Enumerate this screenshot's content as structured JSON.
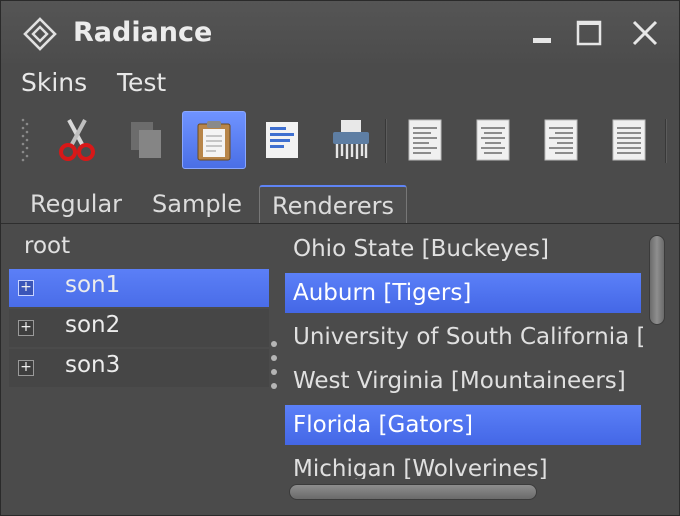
{
  "window": {
    "title": "Radiance",
    "icons": {
      "app": "radiance-diamond-icon",
      "minimize": "minimize-icon",
      "maximize": "maximize-icon",
      "close": "close-icon"
    }
  },
  "menu": {
    "items": [
      "Skins",
      "Test"
    ]
  },
  "toolbar": {
    "buttons": [
      {
        "icon": "cut-icon"
      },
      {
        "icon": "copy-icon"
      },
      {
        "icon": "paste-icon",
        "selected": true
      },
      {
        "icon": "format-icon"
      },
      {
        "icon": "shredder-icon"
      },
      {
        "icon": "align-left-icon"
      },
      {
        "icon": "align-center-icon"
      },
      {
        "icon": "align-right-icon"
      },
      {
        "icon": "align-justify-icon"
      }
    ]
  },
  "tabs": {
    "items": [
      "Regular",
      "Sample",
      "Renderers"
    ],
    "selected": "Renderers"
  },
  "tree": {
    "root": "root",
    "nodes": [
      {
        "label": "son1",
        "selected": true
      },
      {
        "label": "son2"
      },
      {
        "label": "son3"
      }
    ],
    "expander_glyph": "+"
  },
  "list": {
    "items": [
      "Ohio State [Buckeyes]",
      "Auburn [Tigers]",
      "University of South California [",
      "West Virginia [Mountaineers]",
      "Florida [Gators]",
      "Michigan [Wolverines]"
    ],
    "selected": [
      "Auburn [Tigers]",
      "Florida [Gators]"
    ]
  },
  "colors": {
    "selection": "#4a6de8",
    "background": "#4b4b4b",
    "text": "#e6e6e6"
  }
}
